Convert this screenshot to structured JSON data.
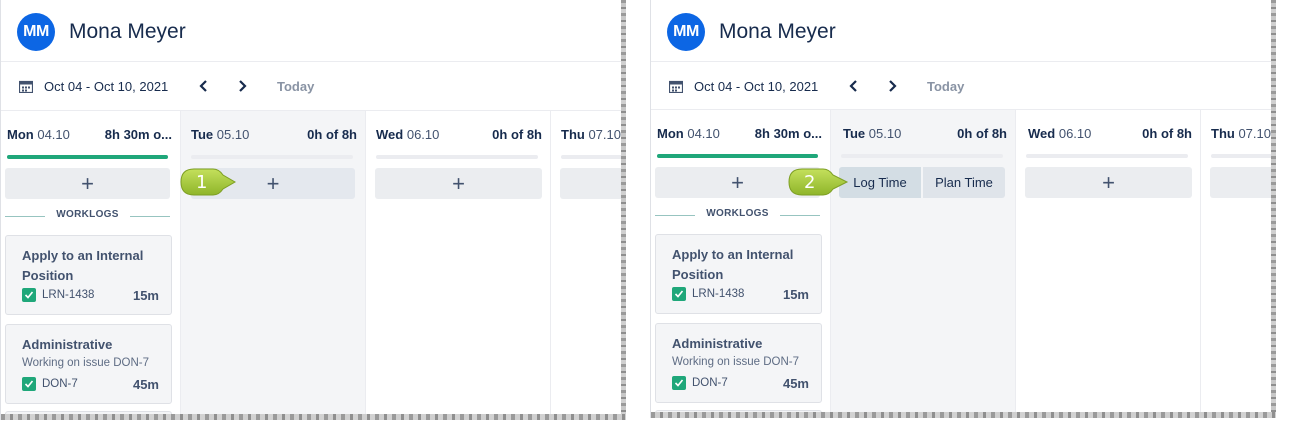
{
  "panels": [
    {
      "user": {
        "initials": "MM",
        "name": "Mona Meyer"
      },
      "date_range": "Oct 04 - Oct 10, 2021",
      "today_label": "Today",
      "step": "1",
      "days": [
        {
          "name": "Mon",
          "date": "04.10",
          "hours": "8h 30m o...",
          "progress": 1.0,
          "add": "+"
        },
        {
          "name": "Tue",
          "date": "05.10",
          "hours": "0h of 8h",
          "progress": 0,
          "add": "+"
        },
        {
          "name": "Wed",
          "date": "06.10",
          "hours": "0h of 8h",
          "progress": 0,
          "add": "+"
        },
        {
          "name": "Thu",
          "date": "07.10",
          "hours": "",
          "progress": 0,
          "add": ""
        }
      ],
      "section_label": "WORKLOGS",
      "cards": [
        {
          "title": "Apply to an Internal Position",
          "subtitle": "",
          "issue": "LRN-1438",
          "duration": "15m"
        },
        {
          "title": "Administrative",
          "subtitle": "Working on issue DON-7",
          "issue": "DON-7",
          "duration": "45m"
        }
      ]
    },
    {
      "user": {
        "initials": "MM",
        "name": "Mona Meyer"
      },
      "date_range": "Oct 04 - Oct 10, 2021",
      "today_label": "Today",
      "step": "2",
      "log_time": "Log Time",
      "plan_time": "Plan Time",
      "days": [
        {
          "name": "Mon",
          "date": "04.10",
          "hours": "8h 30m o...",
          "progress": 1.0,
          "add": "+"
        },
        {
          "name": "Tue",
          "date": "05.10",
          "hours": "0h of 8h",
          "progress": 0,
          "add": ""
        },
        {
          "name": "Wed",
          "date": "06.10",
          "hours": "0h of 8h",
          "progress": 0,
          "add": "+"
        },
        {
          "name": "Thu",
          "date": "07.10",
          "hours": "",
          "progress": 0,
          "add": ""
        }
      ],
      "section_label": "WORKLOGS",
      "cards": [
        {
          "title": "Apply to an Internal Position",
          "subtitle": "",
          "issue": "LRN-1438",
          "duration": "15m"
        },
        {
          "title": "Administrative",
          "subtitle": "Working on issue DON-7",
          "issue": "DON-7",
          "duration": "45m"
        }
      ]
    }
  ],
  "colors": {
    "avatar": "#0c66e4",
    "progress": "#1fa77a",
    "callout": "#a6cc3a",
    "check": "#1fa77a"
  }
}
